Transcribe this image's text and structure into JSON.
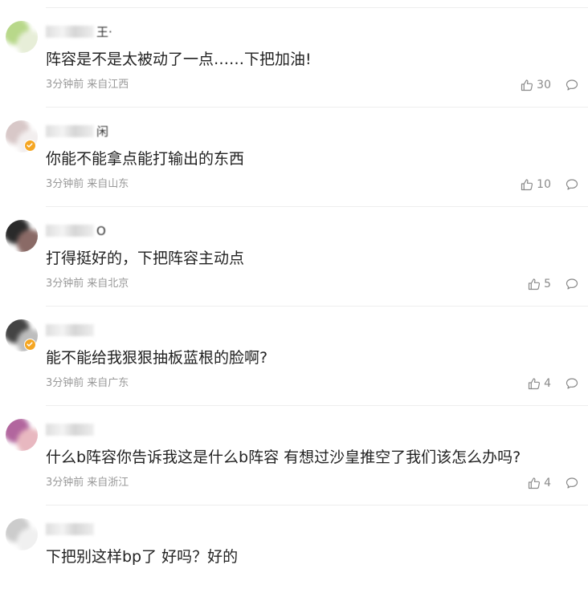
{
  "comments": [
    {
      "username": "王·",
      "content": "阵容是不是太被动了一点……下把加油!",
      "time": "3分钟前",
      "location": "来自江西",
      "likes": "30",
      "avatar_colors": [
        "#b8d88a",
        "#e7eed8"
      ],
      "verified": false
    },
    {
      "username": "闲",
      "content": "你能不能拿点能打输出的东西",
      "time": "3分钟前",
      "location": "来自山东",
      "likes": "10",
      "avatar_colors": [
        "#d8c8c8",
        "#f2eeee"
      ],
      "verified": true
    },
    {
      "username": "O",
      "content": "打得挺好的，下把阵容主动点",
      "time": "3分钟前",
      "location": "来自北京",
      "likes": "5",
      "avatar_colors": [
        "#2a2a2a",
        "#8a6a66"
      ],
      "verified": false
    },
    {
      "username": "",
      "content": "能不能给我狠狠抽板蓝根的脸啊?",
      "time": "3分钟前",
      "location": "来自广东",
      "likes": "4",
      "avatar_colors": [
        "#444444",
        "#bdbdbd"
      ],
      "verified": true
    },
    {
      "username": "",
      "content": "什么b阵容你告诉我这是什么b阵容 有想过沙皇推空了我们该怎么办吗?",
      "time": "3分钟前",
      "location": "来自浙江",
      "likes": "4",
      "avatar_colors": [
        "#b2669e",
        "#e8b8c0"
      ],
      "verified": false
    },
    {
      "username": "",
      "content": "下把别这样bp了 好吗？好的",
      "time": "",
      "location": "",
      "likes": "",
      "avatar_colors": [
        "#cccccc",
        "#f0f0f0"
      ],
      "verified": false
    }
  ],
  "icons": {
    "like": "thumbs-up-icon",
    "reply": "speech-bubble-icon",
    "verified": "verified-badge-icon"
  },
  "colors": {
    "text_primary": "#222222",
    "text_meta": "#999999",
    "icon": "#8a8a8a",
    "divider": "#eeeeee",
    "verified": "#f5a623"
  }
}
